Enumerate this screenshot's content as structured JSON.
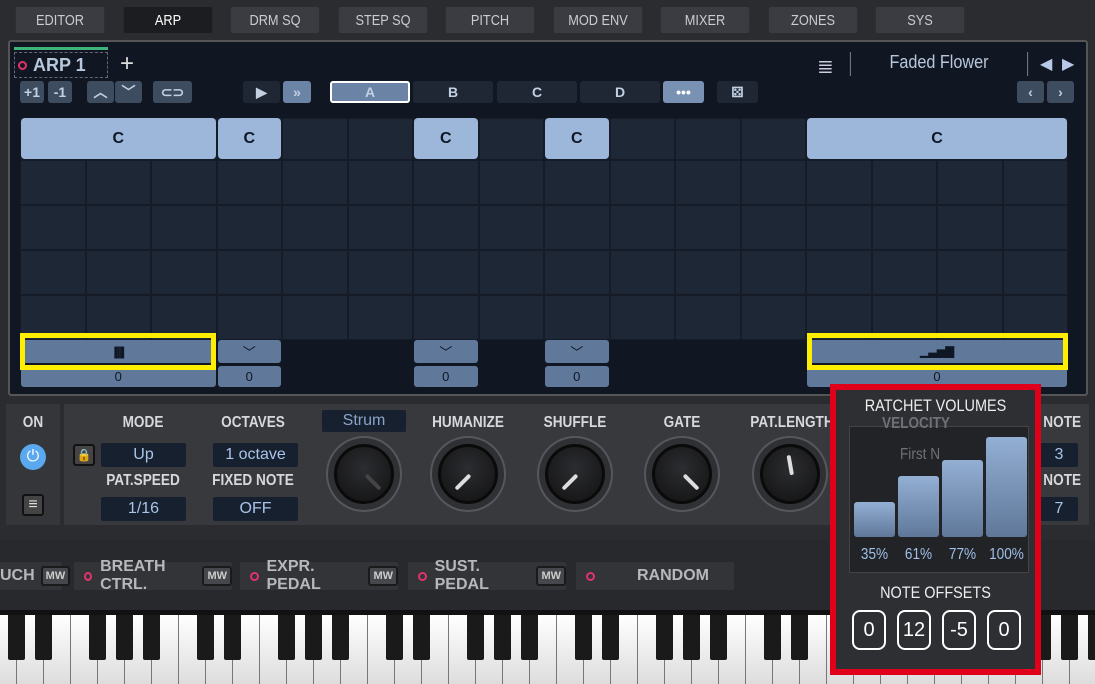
{
  "tabs": [
    "EDITOR",
    "ARP",
    "DRM SQ",
    "STEP SQ",
    "PITCH",
    "MOD ENV",
    "MIXER",
    "ZONES",
    "SYS"
  ],
  "active_tab": "ARP",
  "arp": {
    "name": "ARP 1",
    "add": "+",
    "plus1": "+1",
    "minus1": "-1",
    "up": "^",
    "down": "v",
    "patterns": [
      "A",
      "B",
      "C",
      "D"
    ],
    "more": "•••",
    "preset": "Faded Flower",
    "notes": [
      {
        "label": "C",
        "start": 0,
        "span": 3,
        "ctl": "ratchet-4",
        "val": "0"
      },
      {
        "label": "C",
        "start": 3,
        "span": 1,
        "ctl": "v",
        "val": "0"
      },
      {
        "label": "C",
        "start": 6,
        "span": 1,
        "ctl": "v",
        "val": "0"
      },
      {
        "label": "C",
        "start": 8,
        "span": 1,
        "ctl": "v",
        "val": "0"
      },
      {
        "label": "C",
        "start": 12,
        "span": 4,
        "ctl": "ratchet-vol",
        "val": "0"
      }
    ]
  },
  "controls": {
    "on": "ON",
    "mode_label": "MODE",
    "mode": "Up",
    "octaves_label": "OCTAVES",
    "octaves": "1 octave",
    "patspeed_label": "PAT.SPEED",
    "patspeed": "1/16",
    "fixed_label": "FIXED NOTE",
    "fixed": "OFF",
    "strum": "Strum",
    "humanize": "HUMANIZE",
    "shuffle": "SHUFFLE",
    "gate": "GATE",
    "patlength": "PAT.LENGTH",
    "velocity": "VELOCITY",
    "first": "First N",
    "note1": "NOTE",
    "note1_val": "3",
    "note2": "NOTE",
    "note2_val": "7"
  },
  "mods": [
    {
      "label": "UCH",
      "mw": "MW"
    },
    {
      "label": "BREATH CTRL.",
      "mw": "MW"
    },
    {
      "label": "EXPR. PEDAL",
      "mw": "MW"
    },
    {
      "label": "SUST. PEDAL",
      "mw": "MW"
    },
    {
      "label": "RANDOM"
    }
  ],
  "popup": {
    "title": "RATCHET VOLUMES",
    "volumes": [
      35,
      61,
      77,
      100
    ],
    "volume_labels": [
      "35%",
      "61%",
      "77%",
      "100%"
    ],
    "offsets_title": "NOTE OFFSETS",
    "offsets": [
      "0",
      "12",
      "-5",
      "0"
    ]
  },
  "colors": {
    "highlight_yellow": "#ffee00",
    "highlight_red": "#e0001a",
    "accent_green": "#3fb37a",
    "note": "#9cb7da"
  }
}
